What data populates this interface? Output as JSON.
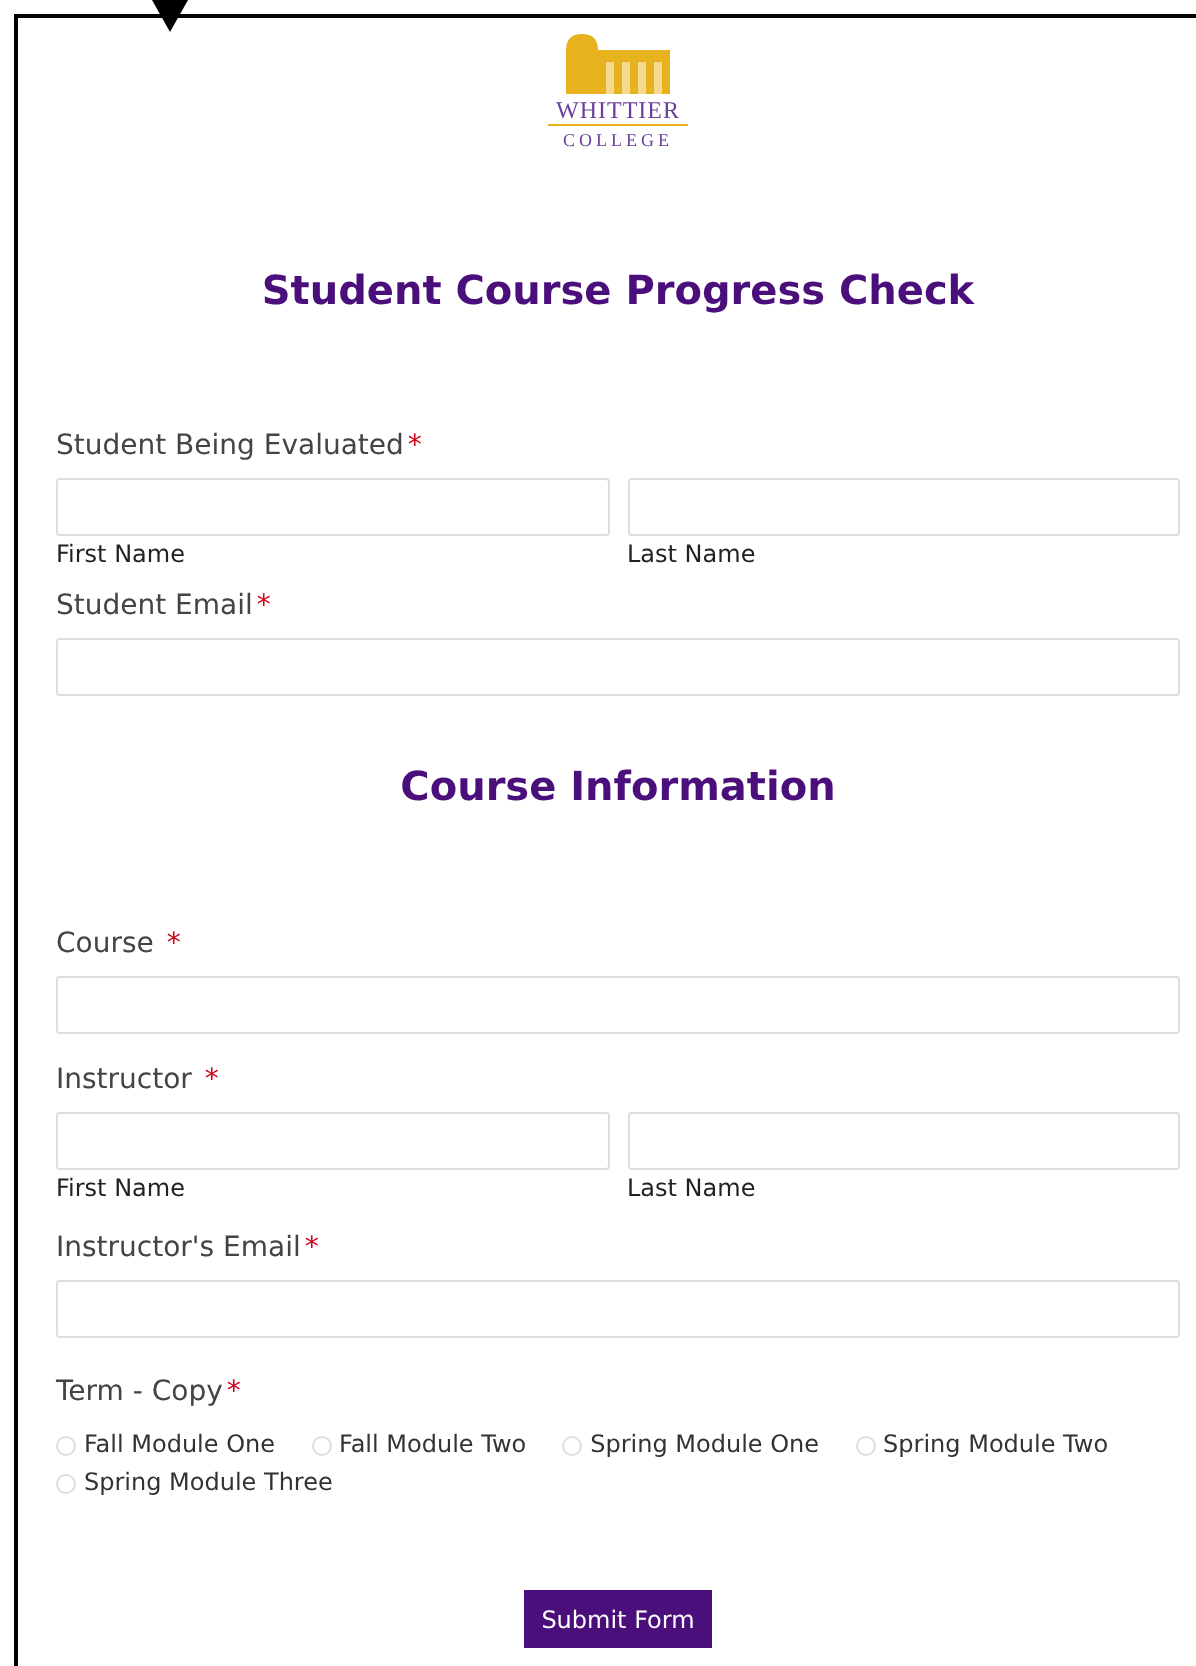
{
  "logo": {
    "name": "WHITTIER",
    "subtitle": "COLLEGE"
  },
  "title": "Student Course Progress Check",
  "student_section": [
    {
      "kind": "name",
      "label": "Student Being Evaluated",
      "required": "*",
      "sublabels": [
        "First Name",
        "Last Name"
      ]
    },
    {
      "kind": "single",
      "label": "Student Email",
      "required": "*"
    }
  ],
  "course_heading": "Course Information",
  "course_section": [
    {
      "kind": "single",
      "label": "Course ",
      "required": "*"
    },
    {
      "kind": "name",
      "label": "Instructor ",
      "required": "*",
      "sublabels": [
        "First Name",
        "Last Name"
      ]
    },
    {
      "kind": "single",
      "label": "Instructor's Email",
      "required": "*"
    }
  ],
  "term": {
    "label": "Term - Copy",
    "required": "*",
    "options": [
      {
        "label": "Fall Module One",
        "selected": false
      },
      {
        "label": "Fall Module Two",
        "selected": false
      },
      {
        "label": "Spring Module One",
        "selected": false
      },
      {
        "label": "Spring Module Two",
        "selected": false
      },
      {
        "label": "Spring Module Three",
        "selected": false
      }
    ]
  },
  "submit_button": "Submit Form"
}
